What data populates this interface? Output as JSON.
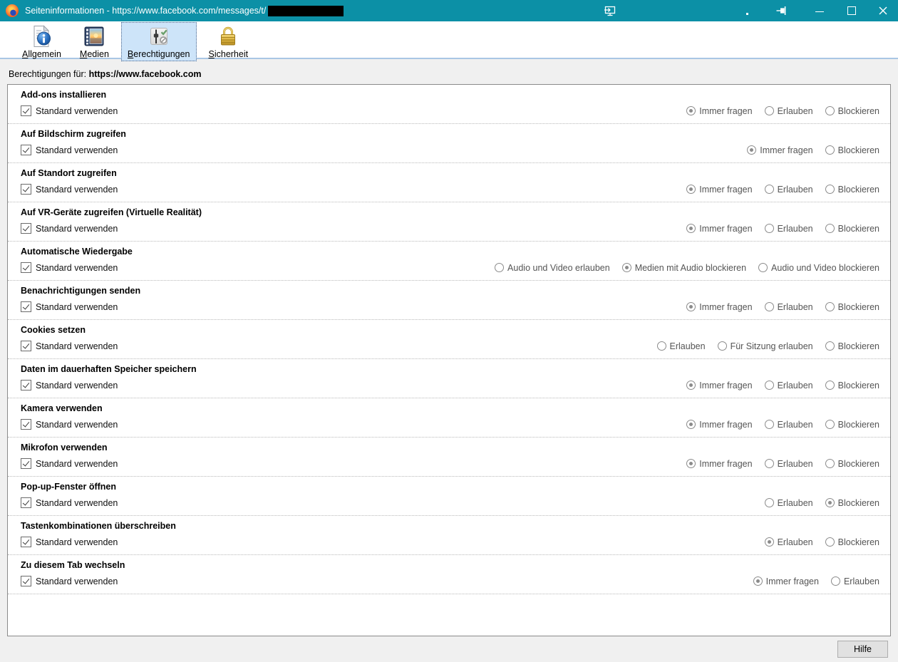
{
  "window": {
    "title": "Seiteninformationen - https://www.facebook.com/messages/t/",
    "title_redacted": true,
    "icons": {
      "app": "firefox-icon",
      "overlay": [
        "screen-share-icon",
        "dot-indicator",
        "pin-icon"
      ],
      "controls": [
        "minimize-icon",
        "maximize-icon",
        "close-icon"
      ]
    }
  },
  "toolbar": {
    "tabs": [
      {
        "label": "Allgemein",
        "icon": "info-document-icon",
        "selected": false
      },
      {
        "label": "Medien",
        "icon": "media-filmstrip-icon",
        "selected": false
      },
      {
        "label": "Berechtigungen",
        "icon": "permissions-slider-icon",
        "selected": true
      },
      {
        "label": "Sicherheit",
        "icon": "security-lock-icon",
        "selected": false
      }
    ]
  },
  "header": {
    "label": "Berechtigungen für:",
    "url": "https://www.facebook.com"
  },
  "permissions": {
    "default_checkbox_label": "Standard verwenden",
    "rows": [
      {
        "title": "Add-ons installieren",
        "checked": true,
        "options": [
          {
            "label": "Immer fragen",
            "selected": true
          },
          {
            "label": "Erlauben",
            "selected": false
          },
          {
            "label": "Blockieren",
            "selected": false
          }
        ]
      },
      {
        "title": "Auf Bildschirm zugreifen",
        "checked": true,
        "options": [
          {
            "label": "Immer fragen",
            "selected": true
          },
          {
            "label": "Blockieren",
            "selected": false
          }
        ]
      },
      {
        "title": "Auf Standort zugreifen",
        "checked": true,
        "options": [
          {
            "label": "Immer fragen",
            "selected": true
          },
          {
            "label": "Erlauben",
            "selected": false
          },
          {
            "label": "Blockieren",
            "selected": false
          }
        ]
      },
      {
        "title": "Auf VR-Geräte zugreifen (Virtuelle Realität)",
        "checked": true,
        "options": [
          {
            "label": "Immer fragen",
            "selected": true
          },
          {
            "label": "Erlauben",
            "selected": false
          },
          {
            "label": "Blockieren",
            "selected": false
          }
        ]
      },
      {
        "title": "Automatische Wiedergabe",
        "checked": true,
        "options": [
          {
            "label": "Audio und Video erlauben",
            "selected": false
          },
          {
            "label": "Medien mit Audio blockieren",
            "selected": true
          },
          {
            "label": "Audio und Video blockieren",
            "selected": false
          }
        ]
      },
      {
        "title": "Benachrichtigungen senden",
        "checked": true,
        "options": [
          {
            "label": "Immer fragen",
            "selected": true
          },
          {
            "label": "Erlauben",
            "selected": false
          },
          {
            "label": "Blockieren",
            "selected": false
          }
        ]
      },
      {
        "title": "Cookies setzen",
        "checked": true,
        "options": [
          {
            "label": "Erlauben",
            "selected": false
          },
          {
            "label": "Für Sitzung erlauben",
            "selected": false
          },
          {
            "label": "Blockieren",
            "selected": false
          }
        ]
      },
      {
        "title": "Daten im dauerhaften Speicher speichern",
        "checked": true,
        "options": [
          {
            "label": "Immer fragen",
            "selected": true
          },
          {
            "label": "Erlauben",
            "selected": false
          },
          {
            "label": "Blockieren",
            "selected": false
          }
        ]
      },
      {
        "title": "Kamera verwenden",
        "checked": true,
        "options": [
          {
            "label": "Immer fragen",
            "selected": true
          },
          {
            "label": "Erlauben",
            "selected": false
          },
          {
            "label": "Blockieren",
            "selected": false
          }
        ]
      },
      {
        "title": "Mikrofon verwenden",
        "checked": true,
        "options": [
          {
            "label": "Immer fragen",
            "selected": true
          },
          {
            "label": "Erlauben",
            "selected": false
          },
          {
            "label": "Blockieren",
            "selected": false
          }
        ]
      },
      {
        "title": "Pop-up-Fenster öffnen",
        "checked": true,
        "options": [
          {
            "label": "Erlauben",
            "selected": false
          },
          {
            "label": "Blockieren",
            "selected": true
          }
        ]
      },
      {
        "title": "Tastenkombinationen überschreiben",
        "checked": true,
        "options": [
          {
            "label": "Erlauben",
            "selected": true
          },
          {
            "label": "Blockieren",
            "selected": false
          }
        ]
      },
      {
        "title": "Zu diesem Tab wechseln",
        "checked": true,
        "options": [
          {
            "label": "Immer fragen",
            "selected": true
          },
          {
            "label": "Erlauben",
            "selected": false
          }
        ]
      }
    ]
  },
  "footer": {
    "help_label": "Hilfe"
  },
  "colors": {
    "titlebar": "#0c90a6",
    "tab_selected_bg": "#cde4f9",
    "dialog_bg": "#f0f0f0",
    "panel_border": "#8a8a8a"
  }
}
